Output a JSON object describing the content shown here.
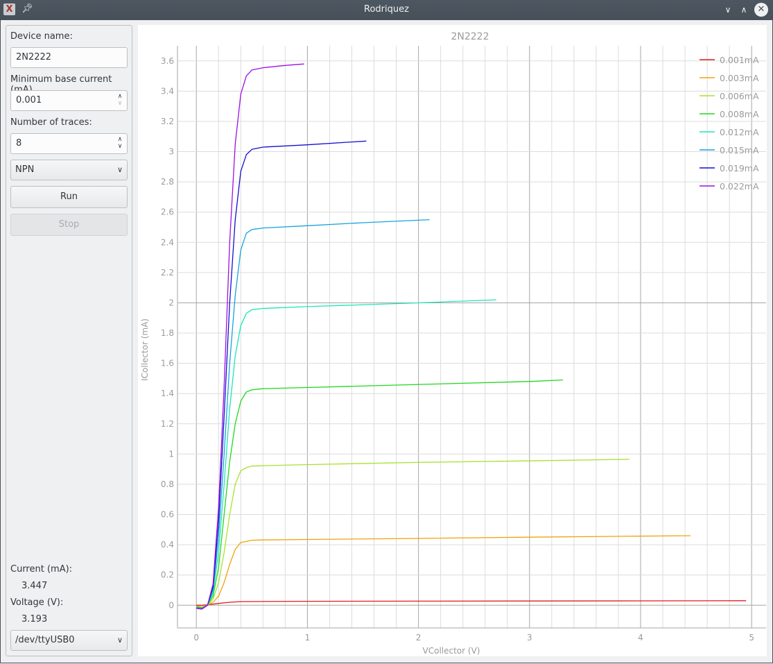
{
  "window": {
    "title": "Rodriquez",
    "app_icon": "app-logo-icon",
    "pin_icon": "pin-icon",
    "controls": {
      "minimize": "chevron-down-icon",
      "maximize": "chevron-up-icon",
      "close": "close-icon"
    }
  },
  "sidebar": {
    "device_name_label": "Device name:",
    "device_name_value": "2N2222",
    "min_base_current_label": "Minimum base current (mA)",
    "min_base_current_value": "0.001",
    "num_traces_label": "Number of traces:",
    "num_traces_value": "8",
    "type_select": "NPN",
    "run_label": "Run",
    "stop_label": "Stop",
    "current_label": "Current (mA):",
    "current_value": "3.447",
    "voltage_label": "Voltage (V):",
    "voltage_value": "3.193",
    "port_select": "/dev/ttyUSB0"
  },
  "chart_data": {
    "type": "line",
    "title": "2N2222",
    "xlabel": "VCollector (V)",
    "ylabel": "ICollector (mA)",
    "xlim": [
      -0.17,
      5.13
    ],
    "ylim": [
      -0.15,
      3.7
    ],
    "xticks": [
      0,
      1,
      2,
      3,
      4,
      5
    ],
    "xtick_labels": [
      "0",
      "1",
      "2",
      "3",
      "4",
      "5"
    ],
    "yticks": [
      0,
      0.2,
      0.4,
      0.6,
      0.8,
      1,
      1.2,
      1.4,
      1.6,
      1.8,
      2,
      2.2,
      2.4,
      2.6,
      2.8,
      3,
      3.2,
      3.4,
      3.6
    ],
    "ytick_labels": [
      "0",
      "0.2",
      "0.4",
      "0.6",
      "0.8",
      "1",
      "1.2",
      "1.4",
      "1.6",
      "1.8",
      "2",
      "2.2",
      "2.4",
      "2.6",
      "2.8",
      "3",
      "3.2",
      "3.4",
      "3.6"
    ],
    "grid": true,
    "legend_position": "top-right",
    "series": [
      {
        "name": "0.001mA",
        "color": "#e31a1c",
        "x": [
          0,
          0.05,
          0.1,
          0.2,
          0.3,
          0.4,
          0.6,
          1.0,
          2.0,
          3.0,
          4.0,
          4.95
        ],
        "y": [
          0,
          0,
          0.003,
          0.012,
          0.02,
          0.024,
          0.025,
          0.026,
          0.027,
          0.028,
          0.029,
          0.03
        ]
      },
      {
        "name": "0.003mA",
        "color": "#f0a30a",
        "x": [
          0,
          0.05,
          0.1,
          0.15,
          0.2,
          0.25,
          0.3,
          0.35,
          0.4,
          0.5,
          0.6,
          1.0,
          2.0,
          3.0,
          4.0,
          4.45
        ],
        "y": [
          -0.005,
          -0.01,
          0,
          0.02,
          0.06,
          0.15,
          0.27,
          0.37,
          0.415,
          0.43,
          0.432,
          0.435,
          0.442,
          0.45,
          0.457,
          0.46
        ]
      },
      {
        "name": "0.006mA",
        "color": "#a6e22e",
        "x": [
          0,
          0.05,
          0.1,
          0.15,
          0.2,
          0.25,
          0.3,
          0.35,
          0.4,
          0.45,
          0.5,
          0.6,
          1.0,
          2.0,
          3.0,
          3.9
        ],
        "y": [
          -0.01,
          -0.015,
          0,
          0.04,
          0.15,
          0.35,
          0.6,
          0.8,
          0.89,
          0.91,
          0.92,
          0.923,
          0.93,
          0.945,
          0.955,
          0.965
        ]
      },
      {
        "name": "0.008mA",
        "color": "#1fd81f",
        "x": [
          0,
          0.05,
          0.1,
          0.15,
          0.2,
          0.25,
          0.3,
          0.35,
          0.4,
          0.45,
          0.5,
          0.6,
          1.0,
          2.0,
          3.0,
          3.3
        ],
        "y": [
          -0.012,
          -0.018,
          0,
          0.06,
          0.25,
          0.6,
          0.95,
          1.2,
          1.35,
          1.41,
          1.425,
          1.432,
          1.44,
          1.46,
          1.48,
          1.49
        ]
      },
      {
        "name": "0.012mA",
        "color": "#1de5b5",
        "x": [
          0,
          0.05,
          0.1,
          0.15,
          0.2,
          0.25,
          0.3,
          0.35,
          0.4,
          0.45,
          0.5,
          0.6,
          1.0,
          2.0,
          2.7
        ],
        "y": [
          -0.015,
          -0.02,
          0,
          0.08,
          0.35,
          0.8,
          1.3,
          1.65,
          1.85,
          1.93,
          1.955,
          1.963,
          1.975,
          2.0,
          2.02
        ]
      },
      {
        "name": "0.015mA",
        "color": "#17a3dd",
        "x": [
          0,
          0.05,
          0.1,
          0.15,
          0.2,
          0.25,
          0.3,
          0.35,
          0.4,
          0.45,
          0.5,
          0.6,
          1.0,
          1.5,
          2.1
        ],
        "y": [
          -0.015,
          -0.02,
          0,
          0.1,
          0.45,
          1.0,
          1.6,
          2.05,
          2.35,
          2.46,
          2.485,
          2.495,
          2.51,
          2.53,
          2.55
        ]
      },
      {
        "name": "0.019mA",
        "color": "#1010d0",
        "x": [
          0,
          0.05,
          0.1,
          0.15,
          0.2,
          0.25,
          0.3,
          0.35,
          0.4,
          0.45,
          0.5,
          0.6,
          1.0,
          1.53
        ],
        "y": [
          -0.02,
          -0.025,
          0,
          0.12,
          0.55,
          1.25,
          2.0,
          2.55,
          2.87,
          2.98,
          3.015,
          3.03,
          3.045,
          3.07
        ]
      },
      {
        "name": "0.022mA",
        "color": "#9b10e0",
        "x": [
          0,
          0.05,
          0.1,
          0.15,
          0.2,
          0.25,
          0.3,
          0.35,
          0.4,
          0.45,
          0.5,
          0.6,
          0.8,
          0.97
        ],
        "y": [
          -0.02,
          -0.025,
          0,
          0.14,
          0.65,
          1.45,
          2.4,
          3.05,
          3.38,
          3.5,
          3.54,
          3.555,
          3.57,
          3.58
        ]
      }
    ]
  }
}
